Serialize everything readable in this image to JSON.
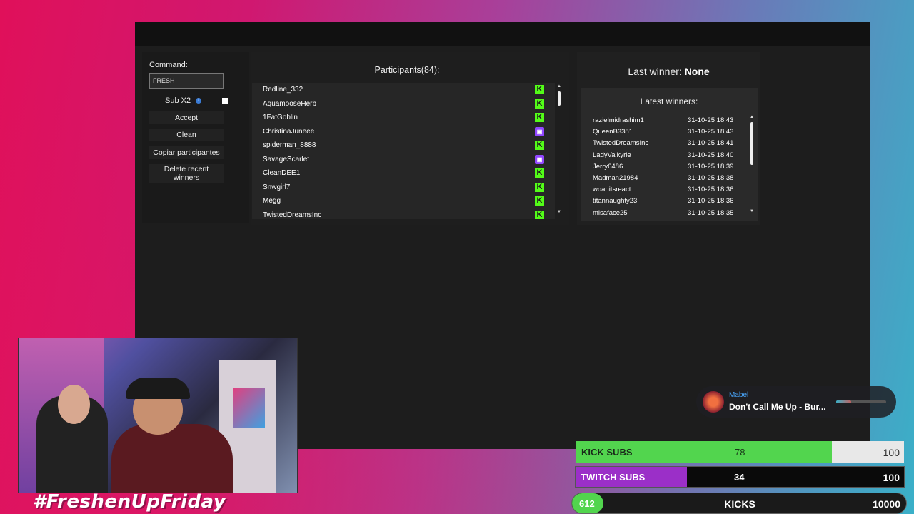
{
  "command": {
    "label": "Command:",
    "value": "FRESH",
    "subx2_label": "Sub X2",
    "buttons": {
      "accept": "Accept",
      "clean": "Clean",
      "copy": "Copiar participantes",
      "delete_line1": "Delete recent",
      "delete_line2": "winners"
    }
  },
  "participants": {
    "title": "Participants(84):",
    "rows": [
      {
        "name": "Redline_332",
        "platform": "kick"
      },
      {
        "name": "AquamooseHerb",
        "platform": "kick"
      },
      {
        "name": "1FatGoblin",
        "platform": "kick"
      },
      {
        "name": "ChristinaJuneee",
        "platform": "twitch"
      },
      {
        "name": "spiderman_8888",
        "platform": "kick"
      },
      {
        "name": "SavageScarlet",
        "platform": "twitch"
      },
      {
        "name": "CleanDEE1",
        "platform": "kick"
      },
      {
        "name": "Snwgirl7",
        "platform": "kick"
      },
      {
        "name": "Megg",
        "platform": "kick"
      },
      {
        "name": "TwistedDreamsInc",
        "platform": "kick"
      }
    ]
  },
  "winners": {
    "last_winner_label": "Last winner:",
    "last_winner_value": "None",
    "latest_title": "Latest winners:",
    "rows": [
      {
        "name": "razielmidrashim1",
        "date": "31-10-25 18:43"
      },
      {
        "name": "QueenB3381",
        "date": "31-10-25 18:43"
      },
      {
        "name": "TwistedDreamsInc",
        "date": "31-10-25 18:41"
      },
      {
        "name": "LadyValkyrie",
        "date": "31-10-25 18:40"
      },
      {
        "name": "Jerry6486",
        "date": "31-10-25 18:39"
      },
      {
        "name": "Madman21984",
        "date": "31-10-25 18:38"
      },
      {
        "name": "woahitsreact",
        "date": "31-10-25 18:36"
      },
      {
        "name": "titannaughty23",
        "date": "31-10-25 18:36"
      },
      {
        "name": "misaface25",
        "date": "31-10-25 18:35"
      }
    ]
  },
  "now_playing": {
    "artist": "Mabel",
    "title": "Don't Call Me Up - Bur...",
    "progress": 0.3
  },
  "hashtag": "#FreshenUpFriday",
  "goals": {
    "kick_subs": {
      "label": "KICK SUBS",
      "current": "78",
      "target": "100",
      "fraction": 0.78
    },
    "twitch_subs": {
      "label": "TWITCH SUBS",
      "current": "34",
      "target": "100",
      "fraction": 0.34
    },
    "kicks": {
      "label": "KICKS",
      "current": "612",
      "target": "10000",
      "fraction": 0.0612
    }
  },
  "colors": {
    "kick": "#53fc18",
    "twitch": "#9146ff"
  }
}
